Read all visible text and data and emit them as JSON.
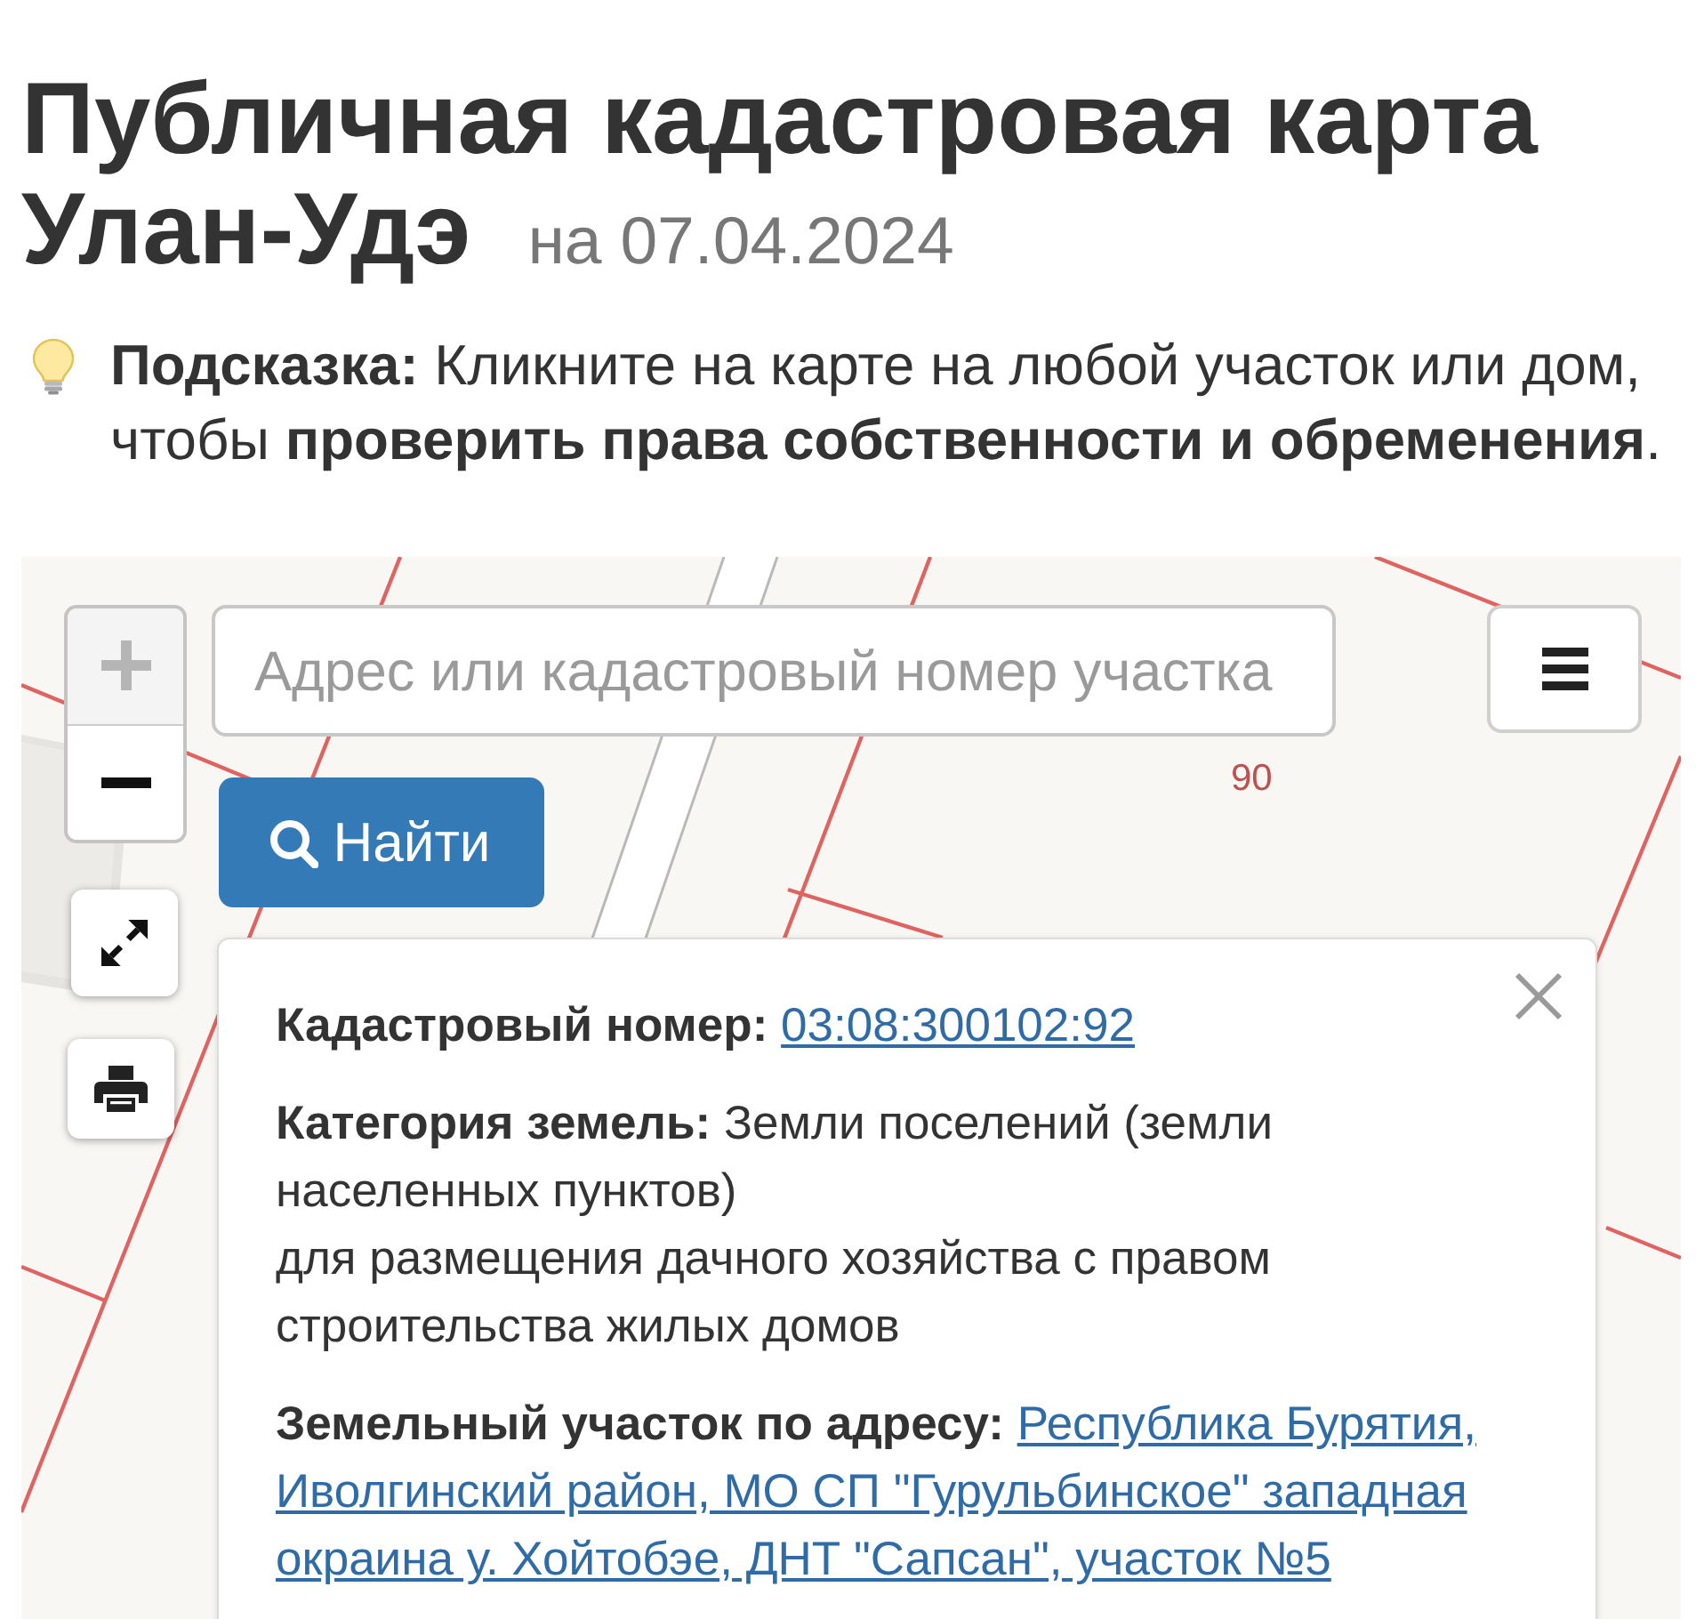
{
  "title": {
    "text": "Публичная кадастровая карта Улан-Удэ",
    "date": "на 07.04.2024"
  },
  "hint": {
    "text": "**Подсказка:** Кликните на карте на любой участок или дом, чтобы **проверить права собственности и обременения**."
  },
  "map": {
    "zoom_controls": [
      {
        "kind": "zoom-in",
        "disabled": true
      },
      {
        "kind": "zoom-out",
        "disabled": false
      }
    ],
    "search": {
      "placeholder": "Адрес или кадастровый номер участка",
      "button": "Найти"
    },
    "parcel_labels": [
      "90"
    ],
    "popup": {
      "fields": [
        {
          "kind": "link",
          "label": "Кадастровый номер:",
          "lines": [
            "03:08:300102:92"
          ]
        },
        {
          "kind": "text",
          "label": "Категория земель:",
          "value": "Земли поселений (земли населенных пунктов)",
          "note": "для размещения дачного хозяйства с правом строительства жилых домов"
        },
        {
          "kind": "link",
          "label": "Земельный участок по адресу:",
          "lines": [
            "Республика Бурятия,",
            "Иволгинский район, МО СП \"Гурульбинское\" западная",
            "окраина у. Хойтобэе, ДНТ \"Сапсан\", участок №5"
          ]
        }
      ]
    }
  }
}
